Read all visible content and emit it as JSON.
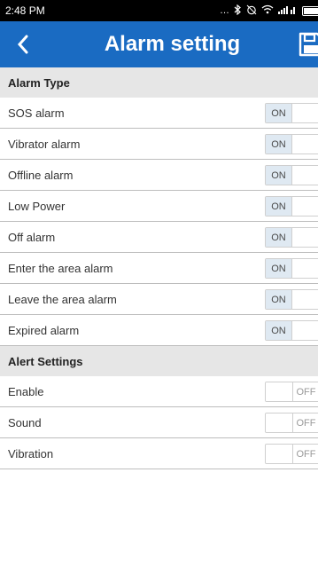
{
  "status_bar": {
    "time": "2:48 PM",
    "icons": [
      "more-dots-icon",
      "bluetooth-icon",
      "alarm-off-icon",
      "wifi-icon",
      "signal-icon",
      "battery-icon"
    ]
  },
  "app_bar": {
    "title": "Alarm setting",
    "back_icon": "chevron-left-icon",
    "save_icon": "save-icon",
    "color": "#1a6bc2"
  },
  "alarm_type": {
    "header": "Alarm Type",
    "items": [
      {
        "label": "SOS alarm",
        "state": "ON"
      },
      {
        "label": "Vibrator alarm",
        "state": "ON"
      },
      {
        "label": "Offline alarm",
        "state": "ON"
      },
      {
        "label": "Low Power",
        "state": "ON"
      },
      {
        "label": "Off alarm",
        "state": "ON"
      },
      {
        "label": "Enter the area alarm",
        "state": "ON"
      },
      {
        "label": "Leave the area alarm",
        "state": "ON"
      },
      {
        "label": "Expired alarm",
        "state": "ON"
      }
    ]
  },
  "alert_settings": {
    "header": "Alert Settings",
    "items": [
      {
        "label": "Enable",
        "state": "OFF"
      },
      {
        "label": "Sound",
        "state": "OFF"
      },
      {
        "label": "Vibration",
        "state": "OFF"
      }
    ]
  }
}
